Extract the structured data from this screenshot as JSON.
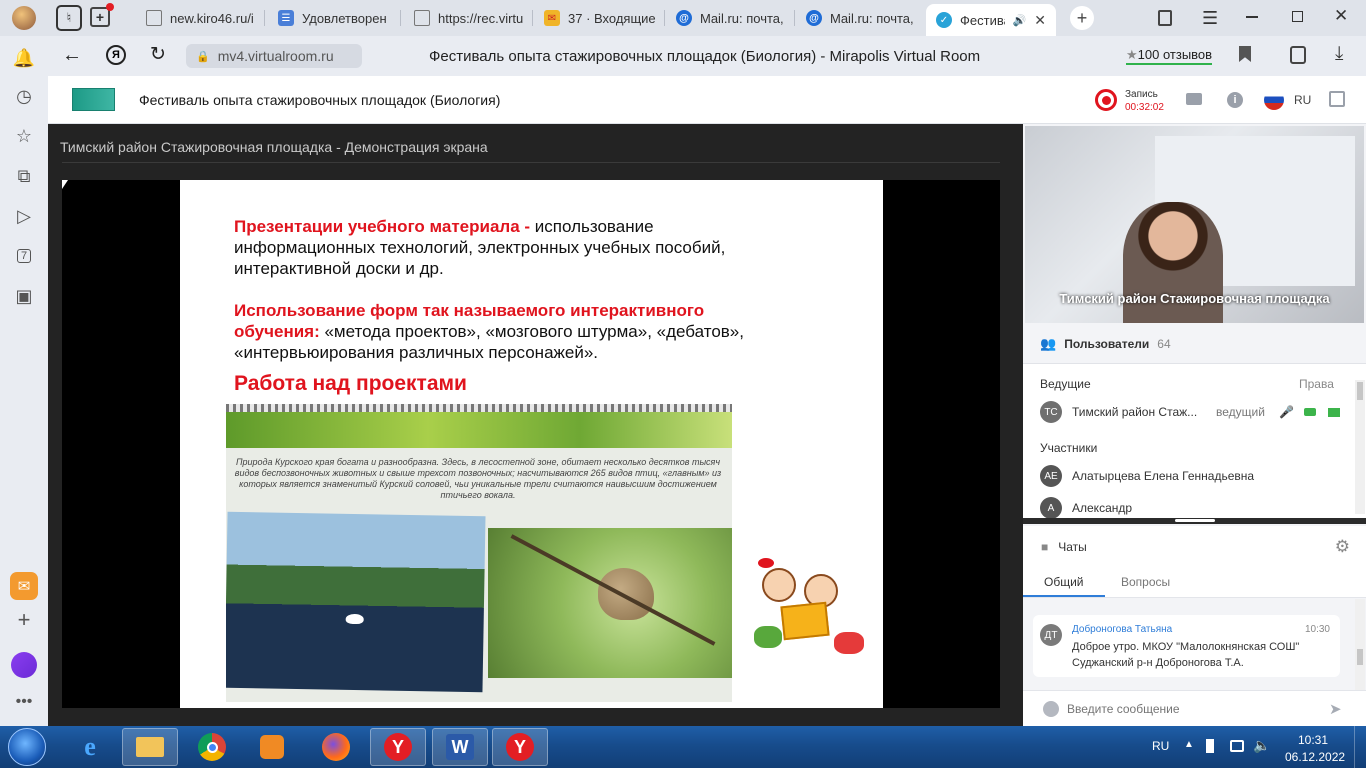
{
  "browser": {
    "tabs": [
      {
        "label": "new.kiro46.ru/i"
      },
      {
        "label": "Удовлетворен"
      },
      {
        "label": "https://rec.virtu"
      },
      {
        "label": "37 · Входящие"
      },
      {
        "label": "Mail.ru: почта,"
      },
      {
        "label": "Mail.ru: почта,"
      },
      {
        "label": "Фестива"
      }
    ],
    "new_tab_symbol": "+",
    "url": "mv4.virtualroom.ru",
    "page_title": "Фестиваль опыта стажировочных площадок (Биология) - Mirapolis Virtual Room",
    "reviews": "100 отзывов",
    "rail_badge": "7"
  },
  "app": {
    "title": "Фестиваль опыта стажировочных площадок (Биология)",
    "record_label": "Запись",
    "record_time": "00:32:02",
    "lang": "RU"
  },
  "stage": {
    "title": "Тимский район Стажировочная площадка - Демонстрация экрана"
  },
  "slide": {
    "p1_red": "Презентации учебного материала -",
    "p1_rest": " использование информационных технологий, электронных учебных пособий, интерактивной доски и др.",
    "p2_red": "Использование форм так называемого интерактивного обучения:",
    "p2_rest": " «метода проектов», «мозгового штурма», «дебатов», «интервьюирования различных персонажей».",
    "heading": "Работа над проектами",
    "photo_text": "Природа Курского края богата и разнообразна. Здесь, в лесостепной зоне, обитает несколько десятков тысяч видов беспозвоночных животных и свыше трехсот позвоночных; насчитываются 265 видов птиц, «главным» из которых является знаменитый Курский соловей, чьи уникальные трели считаются наивысшим достижением птичьего вокала."
  },
  "video": {
    "caption": "Тимский район Стажировочная площадка"
  },
  "users": {
    "header": "Пользователи",
    "count": "64",
    "hosts_label": "Ведущие",
    "rights_label": "Права",
    "host": {
      "initials": "ТС",
      "name": "Тимский район Стаж...",
      "role": "ведущий"
    },
    "participants_label": "Участники",
    "participants": [
      {
        "initials": "АЕ",
        "name": "Алатырцева Елена Геннадьевна"
      },
      {
        "initials": "А",
        "name": "Александр"
      }
    ]
  },
  "chats": {
    "header": "Чаты",
    "tabs": [
      "Общий",
      "Вопросы"
    ],
    "message": {
      "initials": "ДТ",
      "author": "Доброногова Татьяна",
      "time": "10:30",
      "text": "Доброе утро. МКОУ \"Малолокнянская СОШ\" Суджанский р-н Доброногова Т.А."
    },
    "input_placeholder": "Введите сообщение"
  },
  "taskbar": {
    "lang": "RU",
    "time": "10:31",
    "date": "06.12.2022"
  }
}
